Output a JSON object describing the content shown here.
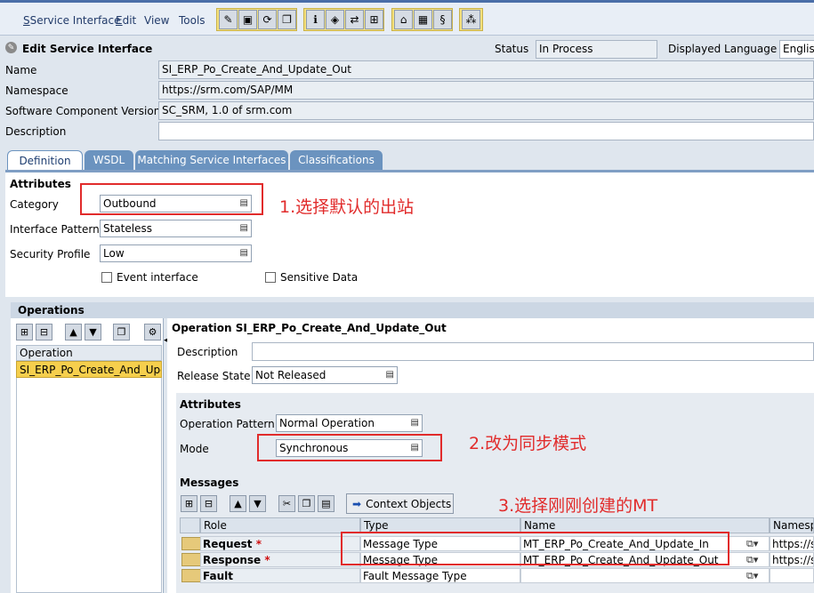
{
  "menu": {
    "items": [
      {
        "text": "Service Interface",
        "u": "S"
      },
      {
        "text": "Edit",
        "u": "E"
      },
      {
        "text": "View",
        "u": ""
      },
      {
        "text": "Tools",
        "u": ""
      }
    ]
  },
  "header": {
    "title": "Edit Service Interface",
    "status_label": "Status",
    "status_value": "In Process",
    "language_label": "Displayed Language",
    "language_value": "Englis"
  },
  "form": {
    "name_label": "Name",
    "name_value": "SI_ERP_Po_Create_And_Update_Out",
    "namespace_label": "Namespace",
    "namespace_value": "https://srm.com/SAP/MM",
    "scv_label": "Software Component Version",
    "scv_value": "SC_SRM, 1.0 of srm.com",
    "description_label": "Description",
    "description_value": ""
  },
  "tabs": [
    "Definition",
    "WSDL",
    "Matching Service Interfaces",
    "Classifications"
  ],
  "attributes": {
    "title": "Attributes",
    "category_label": "Category",
    "category_value": "Outbound",
    "pattern_label": "Interface Pattern",
    "pattern_value": "Stateless",
    "security_label": "Security Profile",
    "security_value": "Low",
    "event_label": "Event interface",
    "sensitive_label": "Sensitive Data"
  },
  "annotations": {
    "a1": "1.选择默认的出站",
    "a2": "2.改为同步模式",
    "a3": "3.选择刚刚创建的MT"
  },
  "operations": {
    "title": "Operations",
    "list_header": "Operation",
    "list_item": "SI_ERP_Po_Create_And_Update_Out",
    "detail_title": "Operation SI_ERP_Po_Create_And_Update_Out",
    "description_label": "Description",
    "release_label": "Release State",
    "release_value": "Not Released",
    "attr_title": "Attributes",
    "op_pattern_label": "Operation Pattern",
    "op_pattern_value": "Normal Operation",
    "mode_label": "Mode",
    "mode_value": "Synchronous"
  },
  "messages": {
    "title": "Messages",
    "context_button": "Context Objects",
    "columns": [
      "Role",
      "Type",
      "Name",
      "Namesp"
    ],
    "rows": [
      {
        "role": "Request",
        "required": true,
        "type": "Message Type",
        "name": "MT_ERP_Po_Create_And_Update_In",
        "ns": "https://srr"
      },
      {
        "role": "Response",
        "required": true,
        "type": "Message Type",
        "name": "MT_ERP_Po_Create_And_Update_Out",
        "ns": "https://srr"
      },
      {
        "role": "Fault",
        "required": false,
        "type": "Fault Message Type",
        "name": "",
        "ns": ""
      }
    ]
  },
  "colors": {
    "accent": "#e12b2b",
    "tab": "#6b93bf",
    "selection": "#f6cf4d"
  }
}
